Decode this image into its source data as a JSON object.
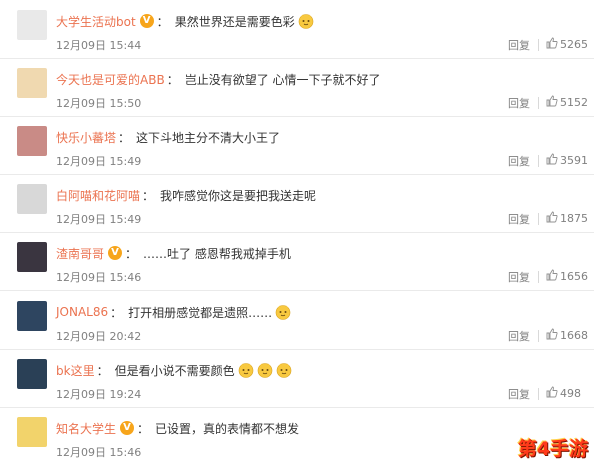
{
  "comments": [
    {
      "username": "大学生活动bot",
      "verified": true,
      "content": "果然世界还是需要色彩",
      "emoji_count": 1,
      "time": "12月09日 15:44",
      "reply_label": "回复",
      "likes": "5265",
      "avatar_color": "#e9e9e9"
    },
    {
      "username": "今天也是可爱的ABB",
      "verified": false,
      "content": "岂止没有欲望了 心情一下子就不好了",
      "emoji_count": 0,
      "time": "12月09日 15:50",
      "reply_label": "回复",
      "likes": "5152",
      "avatar_color": "#f0d9b0"
    },
    {
      "username": "快乐小蕃塔",
      "verified": false,
      "content": "这下斗地主分不清大小王了",
      "emoji_count": 0,
      "time": "12月09日 15:49",
      "reply_label": "回复",
      "likes": "3591",
      "avatar_color": "#c98b86"
    },
    {
      "username": "白阿喵和花阿喵",
      "verified": false,
      "content": "我咋感觉你这是要把我送走呢",
      "emoji_count": 0,
      "time": "12月09日 15:49",
      "reply_label": "回复",
      "likes": "1875",
      "avatar_color": "#d8d8d8"
    },
    {
      "username": "渣南哥哥",
      "verified": true,
      "content": "……吐了 感恩帮我戒掉手机",
      "emoji_count": 0,
      "time": "12月09日 15:46",
      "reply_label": "回复",
      "likes": "1656",
      "avatar_color": "#3a3540"
    },
    {
      "username": "JONAL86",
      "verified": false,
      "content": "打开相册感觉都是遗照……",
      "emoji_count": 1,
      "time": "12月09日 20:42",
      "reply_label": "回复",
      "likes": "1668",
      "avatar_color": "#2e4560"
    },
    {
      "username": "bk这里",
      "verified": false,
      "content": "但是看小说不需要颜色",
      "emoji_count": 3,
      "time": "12月09日 19:24",
      "reply_label": "回复",
      "likes": "498",
      "avatar_color": "#2a4056"
    },
    {
      "username": "知名大学生",
      "verified": true,
      "content": "已设置，真的表情都不想发",
      "emoji_count": 0,
      "time": "12月09日 15:46",
      "reply_label": "",
      "likes": "",
      "avatar_color": "#f2d36b"
    }
  ],
  "colon": "：",
  "verified_mark": "V",
  "watermark": "第4手游",
  "accent_color": "#eb7350"
}
